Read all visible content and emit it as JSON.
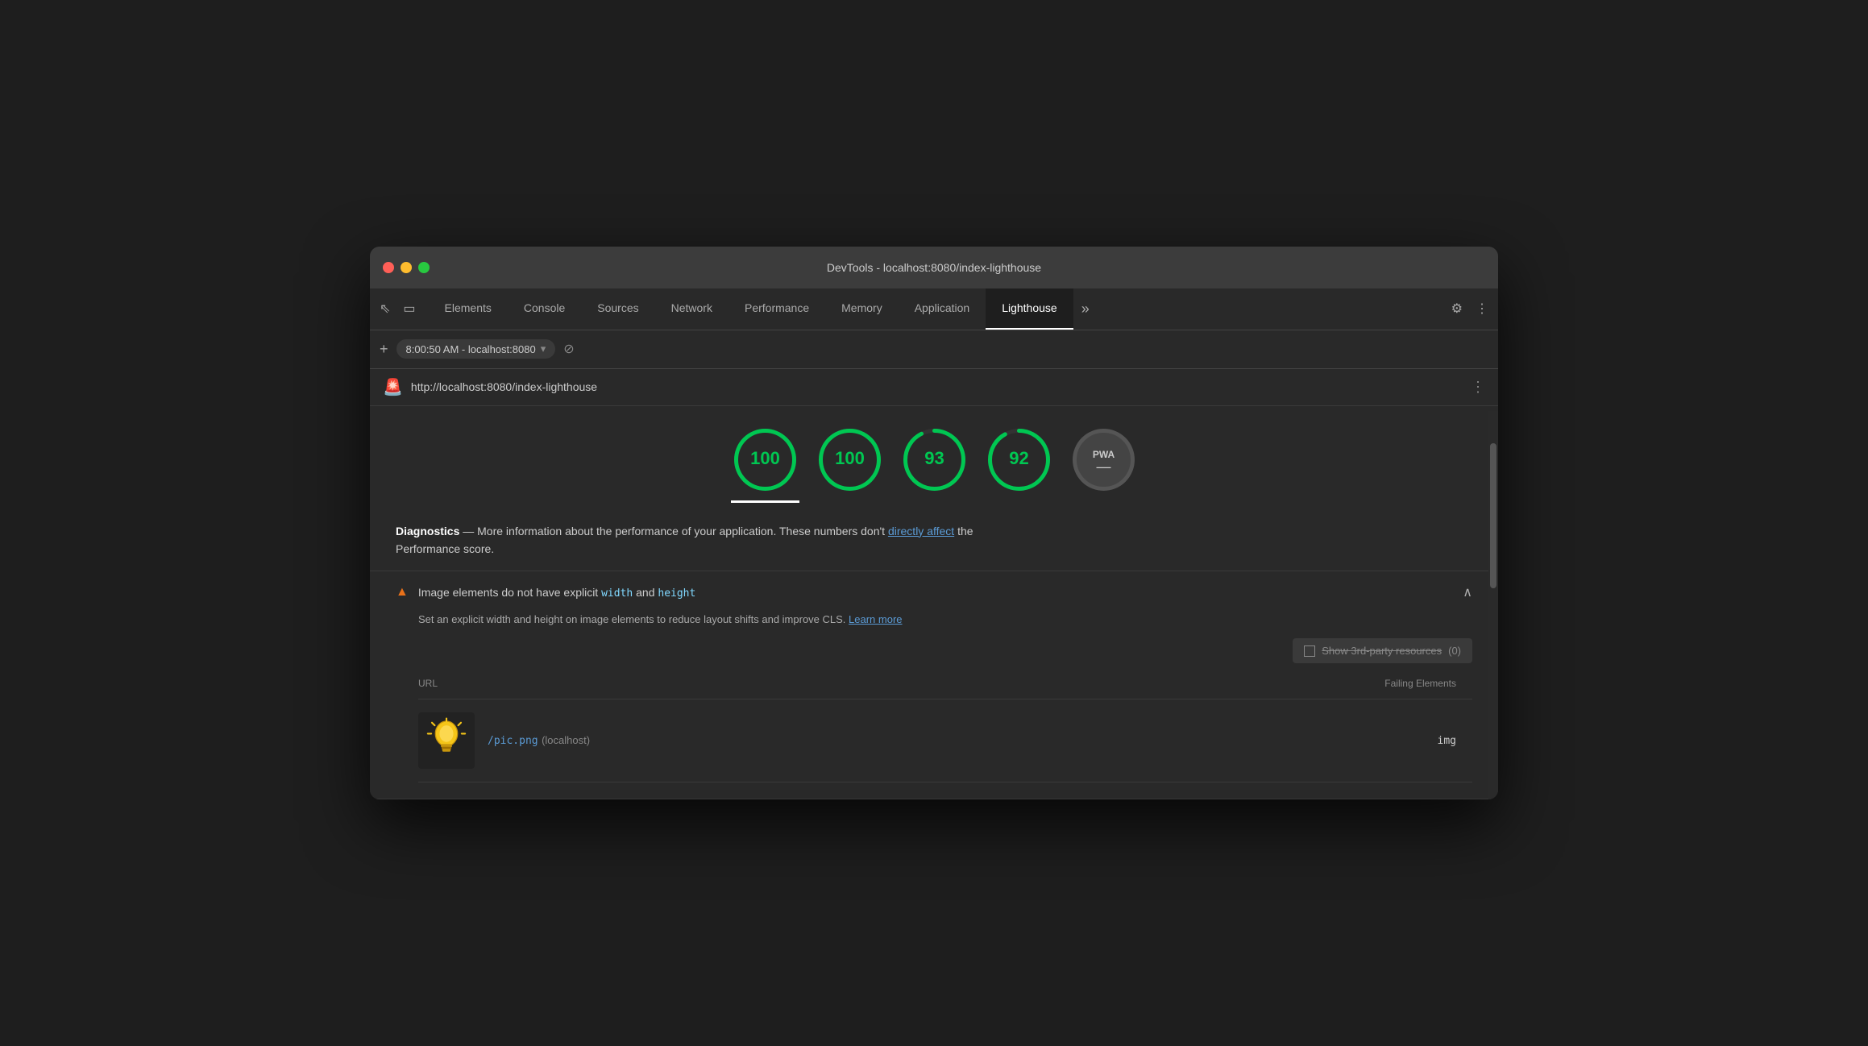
{
  "window": {
    "title": "DevTools - localhost:8080/index-lighthouse",
    "traffic_lights": [
      "red",
      "yellow",
      "green"
    ]
  },
  "devtools": {
    "tabs": [
      {
        "label": "Elements",
        "active": false
      },
      {
        "label": "Console",
        "active": false
      },
      {
        "label": "Sources",
        "active": false
      },
      {
        "label": "Network",
        "active": false
      },
      {
        "label": "Performance",
        "active": false
      },
      {
        "label": "Memory",
        "active": false
      },
      {
        "label": "Application",
        "active": false
      },
      {
        "label": "Lighthouse",
        "active": true
      }
    ],
    "more_tabs_icon": "»",
    "settings_icon": "⚙",
    "dots_icon": "⋮"
  },
  "address_bar": {
    "plus_label": "+",
    "url_text": "8:00:50 AM - localhost:8080",
    "dropdown_arrow": "▾",
    "stop_icon": "⊘"
  },
  "lighthouse_header": {
    "icon": "🚨",
    "url": "http://localhost:8080/index-lighthouse",
    "more_icon": "⋮"
  },
  "scores": [
    {
      "value": "100",
      "color": "#00c752",
      "stroke": "#00c752",
      "active": true
    },
    {
      "value": "100",
      "color": "#00c752",
      "stroke": "#00c752",
      "active": false
    },
    {
      "value": "93",
      "color": "#00c752",
      "stroke": "#00c752",
      "active": false
    },
    {
      "value": "92",
      "color": "#00c752",
      "stroke": "#00c752",
      "active": false
    },
    {
      "value": "PWA",
      "color": "#555",
      "stroke": "#666",
      "active": false,
      "is_pwa": true
    }
  ],
  "diagnostics": {
    "label": "Diagnostics",
    "description": " — More information about the performance of your application. These numbers don't ",
    "link_text": "directly affect",
    "description2": " the",
    "line2": "Performance score."
  },
  "warning": {
    "icon": "▲",
    "title_start": "Image elements do not have explicit ",
    "code1": "width",
    "title_mid": " and ",
    "code2": "height",
    "collapse_icon": "∧",
    "description": "Set an explicit width and height on image elements to reduce layout shifts and improve CLS. ",
    "learn_more_text": "Learn more",
    "third_party": {
      "label": "Show 3rd-party resources",
      "count": "(0)"
    },
    "table": {
      "col_url": "URL",
      "col_failing": "Failing Elements",
      "rows": [
        {
          "url": "/pic.png",
          "origin": "(localhost)",
          "failing_element": "img"
        }
      ]
    }
  }
}
